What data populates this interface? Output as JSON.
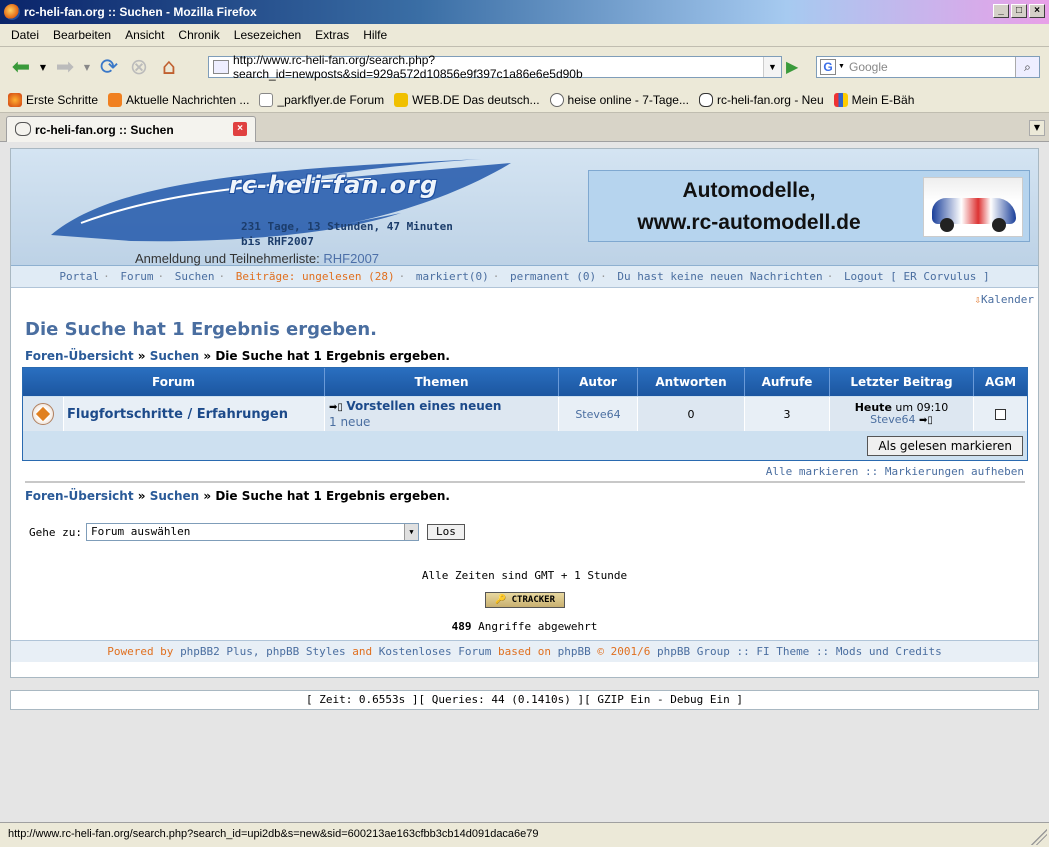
{
  "window": {
    "title": "rc-heli-fan.org :: Suchen - Mozilla Firefox"
  },
  "menu": [
    "Datei",
    "Bearbeiten",
    "Ansicht",
    "Chronik",
    "Lesezeichen",
    "Extras",
    "Hilfe"
  ],
  "url": "http://www.rc-heli-fan.org/search.php?search_id=newposts&sid=929a572d10856e9f397c1a86e6e5d90b",
  "search_placeholder": "Google",
  "bookmarks": [
    "Erste Schritte",
    "Aktuelle Nachrichten ...",
    "_parkflyer.de Forum",
    "WEB.DE Das deutsch...",
    "heise online - 7-Tage...",
    "rc-heli-fan.org - Neu",
    "Mein E-Bäh"
  ],
  "tab": {
    "label": "rc-heli-fan.org :: Suchen"
  },
  "header": {
    "logo": "rc-heli-fan.org",
    "countdown1": "231 Tage, 13 Stunden, 47 Minuten",
    "countdown2": "bis RHF2007",
    "banner1": "Automodelle,",
    "banner2": "www.rc-automodell.de",
    "anmeldung": "Anmeldung und Teilnehmerliste:",
    "anmeldung_link": "RHF2007"
  },
  "nav": {
    "portal": "Portal",
    "forum": "Forum",
    "suchen": "Suchen",
    "beitraege": "Beiträge:",
    "ungelesen": "ungelesen (28)",
    "markiert": "markiert(0)",
    "permanent": "permanent (0)",
    "nachrichten": "Du hast keine neuen Nachrichten",
    "logout": "Logout [ ER Corvulus ]"
  },
  "kalender": "Kalender",
  "page_title": "Die Suche hat 1 Ergebnis ergeben.",
  "crumb": {
    "home": "Foren-Übersicht",
    "search": "Suchen",
    "current": "» Die Suche hat 1 Ergebnis ergeben."
  },
  "table": {
    "headers": [
      "Forum",
      "Themen",
      "Autor",
      "Antworten",
      "Aufrufe",
      "Letzter Beitrag",
      "AGM"
    ],
    "row": {
      "forum": "Flugfortschritte / Erfahrungen",
      "topic": "Vorstellen eines neuen",
      "new": "1 neue",
      "author": "Steve64",
      "replies": "0",
      "views": "3",
      "last_day": "Heute",
      "last_time": "um 09:10",
      "last_author": "Steve64"
    },
    "mark_read": "Als gelesen markieren"
  },
  "mark_all": "Alle markieren",
  "unmark": "Markierungen aufheben",
  "goto_label": "Gehe zu:",
  "goto_value": "Forum auswählen",
  "goto_btn": "Los",
  "times": "Alle Zeiten sind GMT + 1 Stunde",
  "tracker": "CTRACKER",
  "attacks_count": "489",
  "attacks_text": "Angriffe abgewehrt",
  "powered": {
    "a": "Powered by",
    "phpbb2": "phpBB2 Plus",
    "b": ",",
    "styles": "phpBB Styles",
    "c": "and",
    "kf": "Kostenloses Forum",
    "d": "based on",
    "phpbb": "phpBB",
    "e": "© 2001/6",
    "group": "phpBB Group",
    "f": "::",
    "fi": "FI Theme",
    "g": "::",
    "mods": "Mods und Credits"
  },
  "debug": "[ Zeit: 0.6553s ][ Queries: 44 (0.1410s) ][ GZIP Ein - Debug Ein ]",
  "status": "http://www.rc-heli-fan.org/search.php?search_id=upi2db&s=new&sid=600213ae163cfbb3cb14d091daca6e79"
}
